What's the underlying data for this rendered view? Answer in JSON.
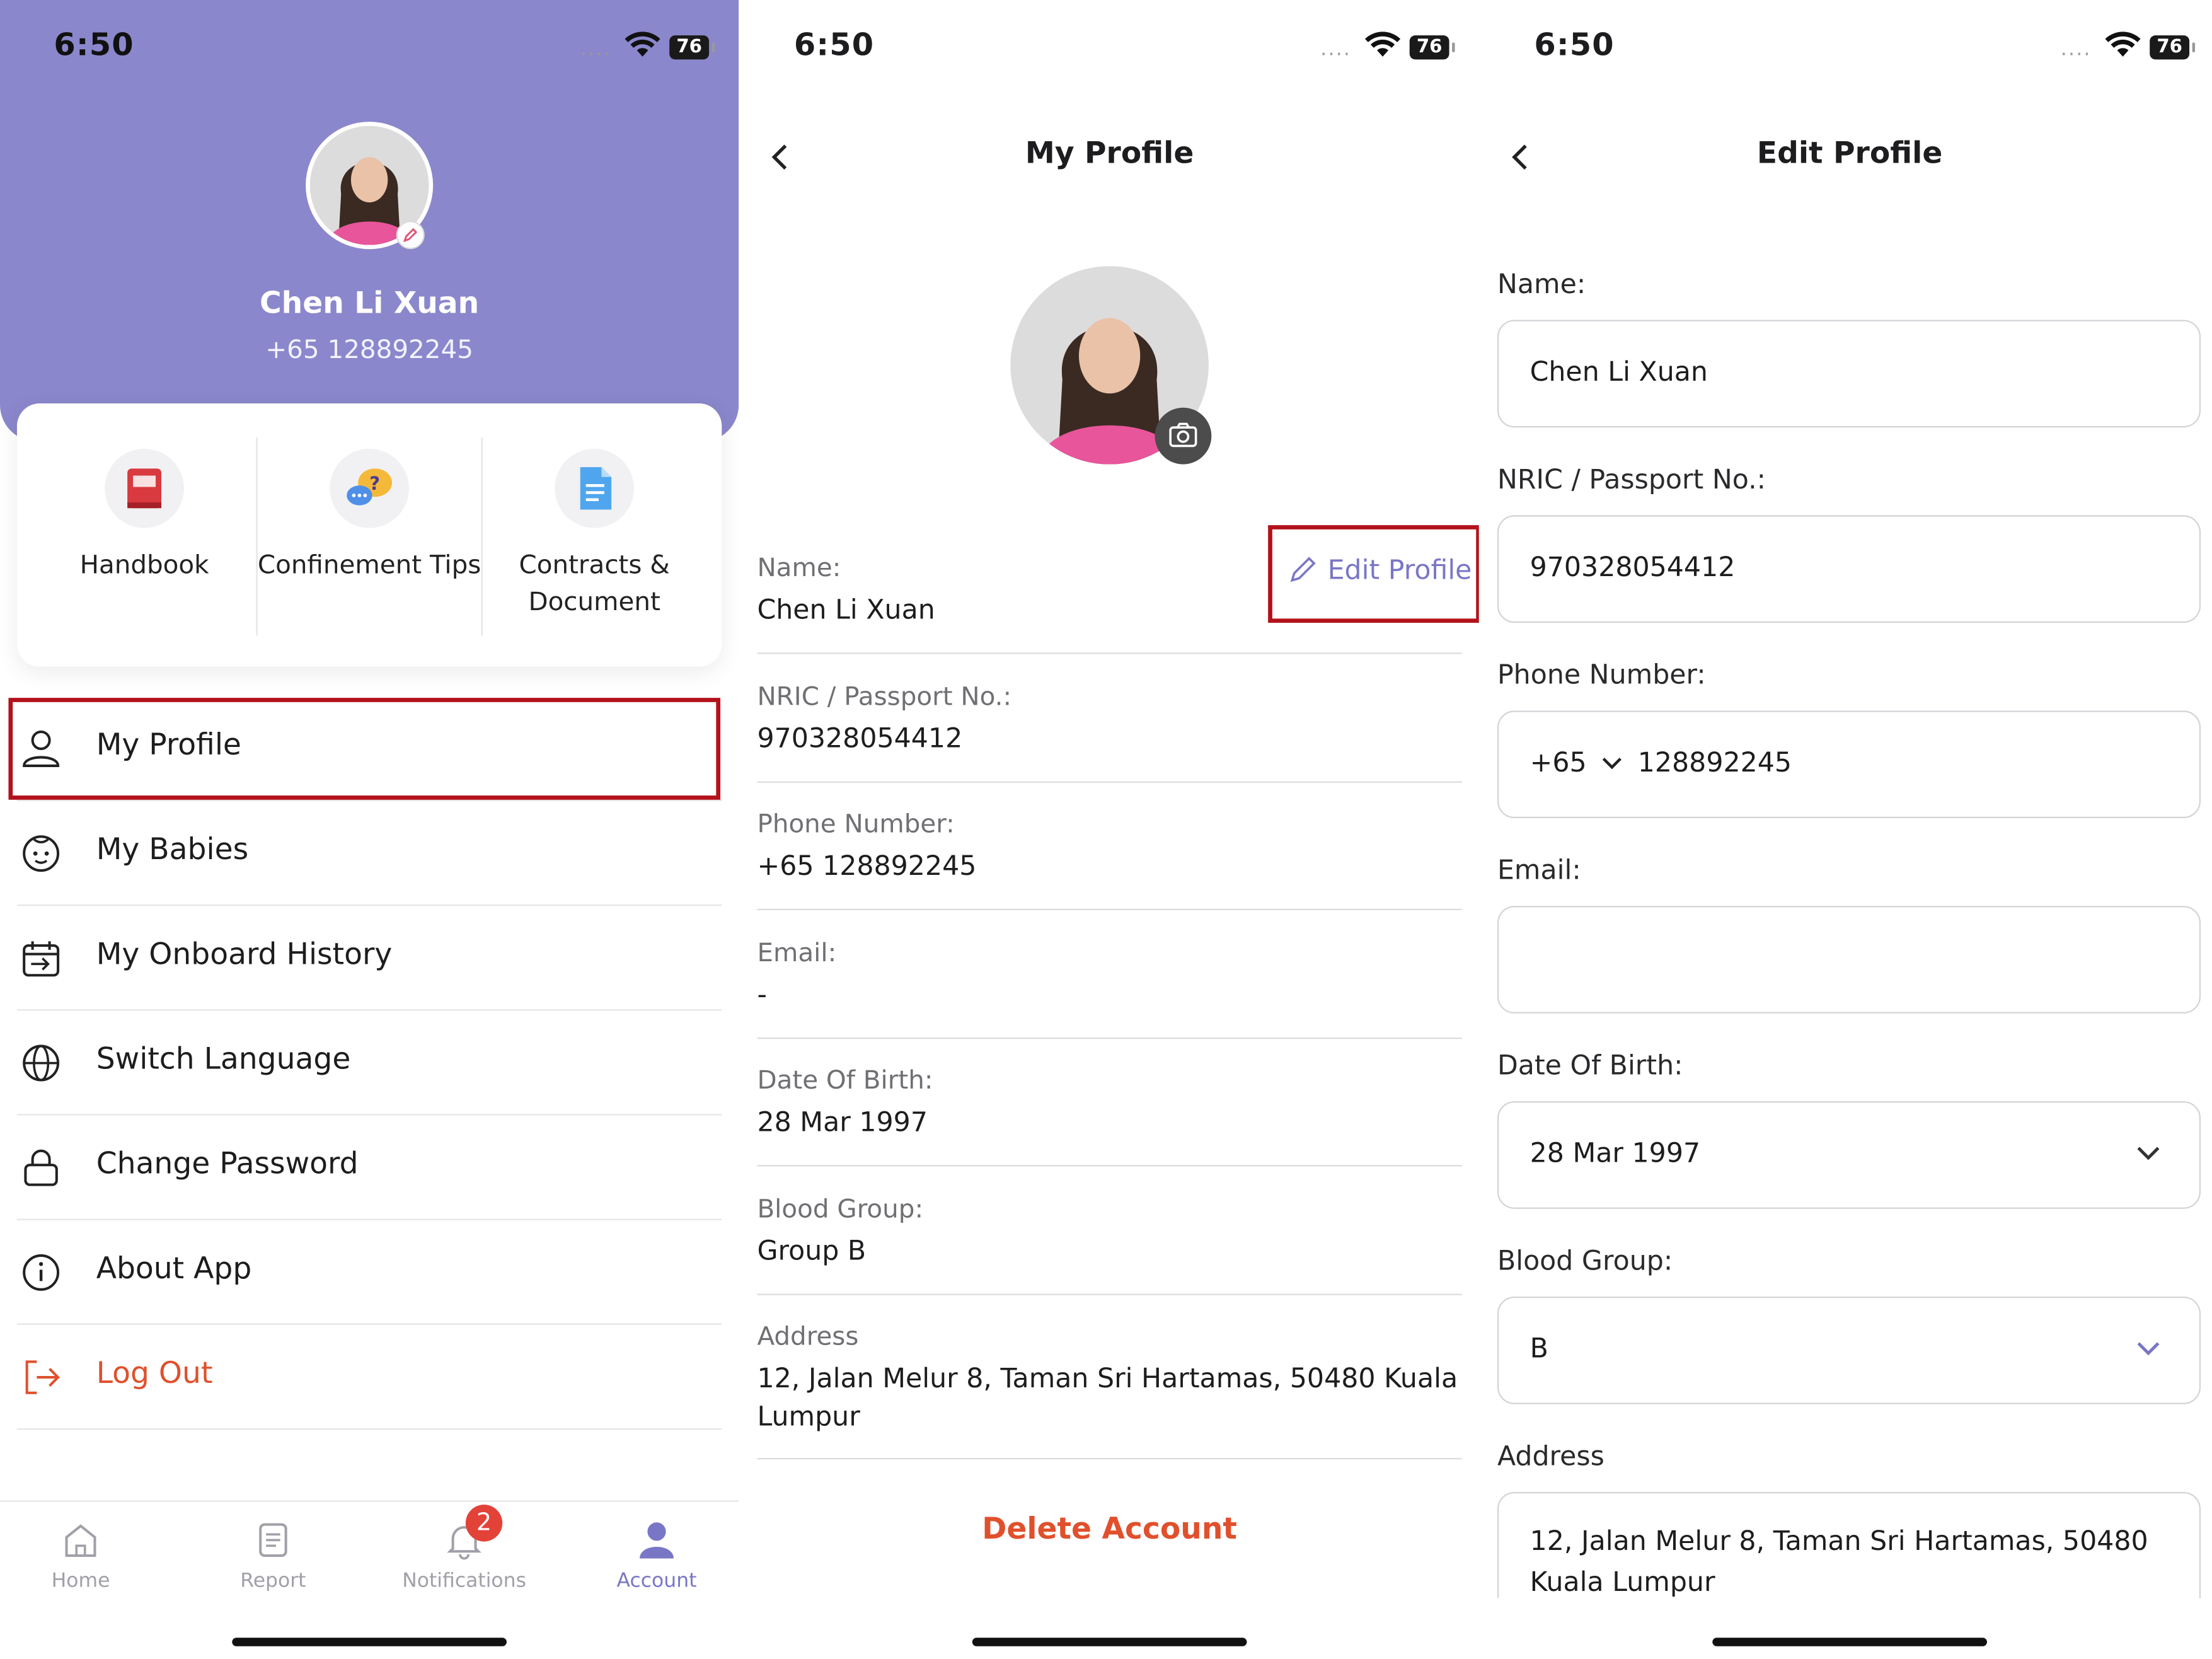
{
  "status_bar": {
    "time": "6:50",
    "battery": "76",
    "signal": "...."
  },
  "menu_screen": {
    "user_name": "Chen Li Xuan",
    "user_phone": "+65 128892245",
    "quick_actions": [
      {
        "label": "Handbook",
        "icon": "book-icon"
      },
      {
        "label": "Confinement Tips",
        "icon": "chat-question-icon"
      },
      {
        "label": "Contracts & Document",
        "icon": "document-icon"
      }
    ],
    "menu_items": [
      {
        "label": "My Profile",
        "icon": "user-icon"
      },
      {
        "label": "My Babies",
        "icon": "baby-icon"
      },
      {
        "label": "My Onboard History",
        "icon": "calendar-history-icon"
      },
      {
        "label": "Switch Language",
        "icon": "globe-icon"
      },
      {
        "label": "Change Password",
        "icon": "lock-icon"
      },
      {
        "label": "About App",
        "icon": "info-icon"
      },
      {
        "label": "Log Out",
        "icon": "logout-icon"
      }
    ],
    "tabs": [
      {
        "label": "Home",
        "icon": "home-icon"
      },
      {
        "label": "Report",
        "icon": "report-icon"
      },
      {
        "label": "Notifications",
        "icon": "bell-icon"
      },
      {
        "label": "Account",
        "icon": "account-icon"
      }
    ],
    "notification_badge": "2",
    "accent_color": "#8b87cc",
    "logout_color": "#e0502c"
  },
  "profile_screen": {
    "title": "My Profile",
    "edit_label": "Edit Profile",
    "fields": [
      {
        "label": "Name:",
        "value": "Chen Li Xuan"
      },
      {
        "label": "NRIC / Passport No.:",
        "value": "970328054412"
      },
      {
        "label": "Phone Number:",
        "value": "+65 128892245"
      },
      {
        "label": "Email:",
        "value": "-"
      },
      {
        "label": "Date Of Birth:",
        "value": "28 Mar 1997"
      },
      {
        "label": "Blood Group:",
        "value": "Group B"
      },
      {
        "label": "Address",
        "value": "12, Jalan Melur 8, Taman Sri Hartamas, 50480 Kuala Lumpur"
      }
    ],
    "delete_label": "Delete Account"
  },
  "edit_screen": {
    "title": "Edit Profile",
    "name_label": "Name:",
    "name_value": "Chen Li Xuan",
    "nric_label": "NRIC / Passport No.:",
    "nric_value": "970328054412",
    "phone_label": "Phone Number:",
    "phone_code": "+65",
    "phone_value": "128892245",
    "email_label": "Email:",
    "email_value": "",
    "dob_label": "Date Of Birth:",
    "dob_value": "28 Mar 1997",
    "blood_label": "Blood Group:",
    "blood_value": "B",
    "address_label": "Address",
    "address_value": "12, Jalan Melur 8, Taman Sri Hartamas, 50480 Kuala Lumpur"
  }
}
